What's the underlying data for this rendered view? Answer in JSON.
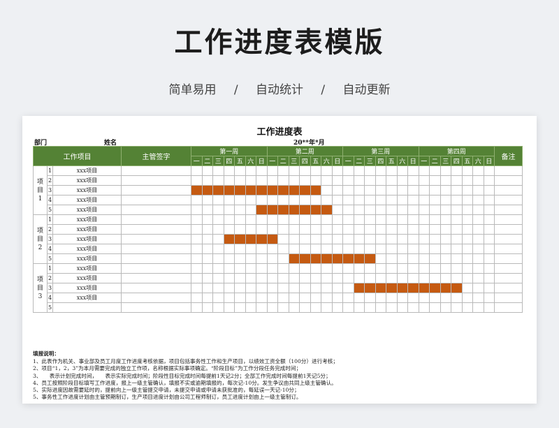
{
  "hero": {
    "title": "工作进度表模版",
    "subtitles": [
      "简单易用",
      "/",
      "自动统计",
      "/",
      "自动更新"
    ]
  },
  "sheet": {
    "title": "工作进度表",
    "dept_label": "部门",
    "name_label": "姓名",
    "date_label": "20**年*月",
    "headers": {
      "project": "工作项目",
      "supervisor": "主管签字",
      "remark": "备注"
    },
    "weeks": [
      "第一周",
      "第二周",
      "第三周",
      "第四周"
    ],
    "days": [
      "一",
      "二",
      "三",
      "四",
      "五",
      "六",
      "日"
    ],
    "groups": [
      {
        "label": "项目1",
        "items": [
          "xxx项目",
          "xxx项目",
          "xxx项目",
          "xxx项目",
          "xxx项目"
        ]
      },
      {
        "label": "项目2",
        "items": [
          "xxx项目",
          "xxx项目",
          "xxx项目",
          "xxx项目",
          "xxx项目"
        ]
      },
      {
        "label": "项目3",
        "items": [
          "xxx项目",
          "xxx项目",
          "xxx项目",
          "xxx项目",
          ""
        ]
      }
    ],
    "progress": [
      [
        null,
        null,
        [
          0,
          12
        ],
        null,
        [
          6,
          13
        ]
      ],
      [
        null,
        null,
        [
          3,
          8
        ],
        null,
        [
          9,
          17
        ]
      ],
      [
        null,
        null,
        [
          15,
          25
        ],
        null,
        null
      ]
    ],
    "colors": {
      "header": "#548235",
      "bar": "#c55a11"
    }
  },
  "notes": {
    "title": "填报说明：",
    "lines": [
      "1、此表作为机关、事业部及员工月度工作进度考核依据，项目包括事务性工作和生产项目，以绩效工资全额（100分）进行考核；",
      "2、项目“1，2，3”为本月需要完成的独立工作项，名称根据实际事项确定。“阶段目标”为工作分段任务完成时间；",
      "3、　　表示计划完成时间，　　表示实际完成时间；阶段性目标完成时间每提前1天记2分；全部工作完成时间每提前1天记5分；",
      "4、员工按照阶段目标填写工作进度，报上一级主管确认，填报不实或逾期填报的，每次记-10分。发生争议由共同上级主管确认。",
      "5、实际进度因故需要延时的，提前向上一级主管提交申请，未提交申请或申请未获批准的，每延误一天记-10分；",
      "5、事务性工作进度计划由主管预期制订，生产项目进度计划由公司工程师制订，员工进度计划由上一级主管制订。"
    ]
  }
}
